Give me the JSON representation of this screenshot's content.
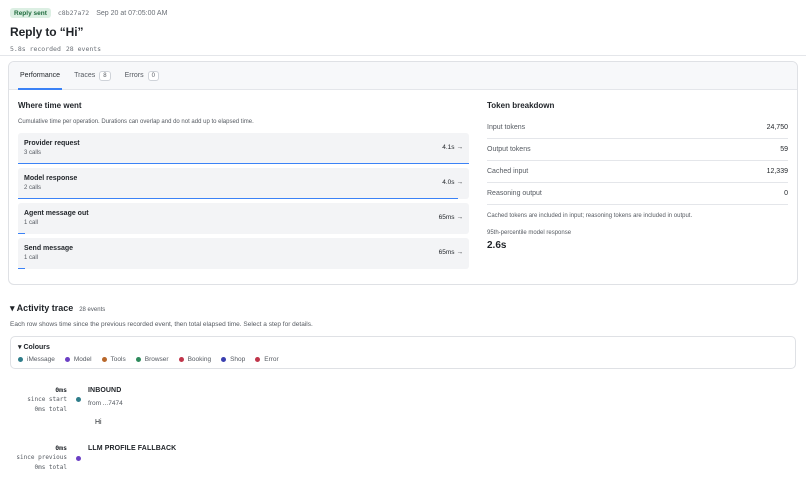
{
  "header": {
    "status_badge": "Reply sent",
    "run_id": "c8b27a72",
    "timestamp": "Sep 20 at 07:05:00 AM",
    "title": "Reply to “Hi”",
    "recorded": "5.8s recorded",
    "events": "28 events"
  },
  "tabs": [
    {
      "label": "Performance",
      "count": null
    },
    {
      "label": "Traces",
      "count": "8"
    },
    {
      "label": "Errors",
      "count": "0"
    }
  ],
  "performance": {
    "heading": "Where time went",
    "note": "Cumulative time per operation. Durations can overlap and do not add up to elapsed time.",
    "operations": [
      {
        "name": "Provider request",
        "calls": "3 calls",
        "time": "4.1s",
        "fill": 1.0
      },
      {
        "name": "Model response",
        "calls": "2 calls",
        "time": "4.0s",
        "fill": 0.975
      },
      {
        "name": "Agent message out",
        "calls": "1 call",
        "time": "65ms",
        "fill": 0.016
      },
      {
        "name": "Send message",
        "calls": "1 call",
        "time": "65ms",
        "fill": 0.016
      }
    ],
    "arrow": "→"
  },
  "tokens": {
    "heading": "Token breakdown",
    "rows": [
      {
        "label": "Input tokens",
        "value": "24,750"
      },
      {
        "label": "Output tokens",
        "value": "59"
      },
      {
        "label": "Cached input",
        "value": "12,339"
      },
      {
        "label": "Reasoning output",
        "value": "0"
      }
    ],
    "note": "Cached tokens are included in input; reasoning tokens are included in output.",
    "p95_label": "95th-percentile model response",
    "p95_value": "2.6s"
  },
  "activity": {
    "heading": "▾ Activity trace",
    "count": "28 events",
    "note": "Each row shows time since the previous recorded event, then total elapsed time. Select a step for details.",
    "legend_title": "▾ Colours",
    "legend": [
      {
        "label": "iMessage",
        "color": "#2f7d8a"
      },
      {
        "label": "Model",
        "color": "#6b3fc4"
      },
      {
        "label": "Tools",
        "color": "#b8672a"
      },
      {
        "label": "Browser",
        "color": "#2e8a5c"
      },
      {
        "label": "Booking",
        "color": "#c0354a"
      },
      {
        "label": "Shop",
        "color": "#3a3fb0"
      },
      {
        "label": "Error",
        "color": "#c0354a"
      }
    ],
    "events": [
      {
        "delta": "0ms",
        "delta_label": "since start",
        "total": "0ms total",
        "title": "INBOUND",
        "sub": "from ...7474",
        "body": "Hi",
        "color": "#2f7d8a"
      },
      {
        "delta": "0ms",
        "delta_label": "since previous",
        "total": "0ms total",
        "title": "LLM PROFILE FALLBACK",
        "sub": "",
        "body": "",
        "color": "#6b3fc4"
      }
    ]
  }
}
